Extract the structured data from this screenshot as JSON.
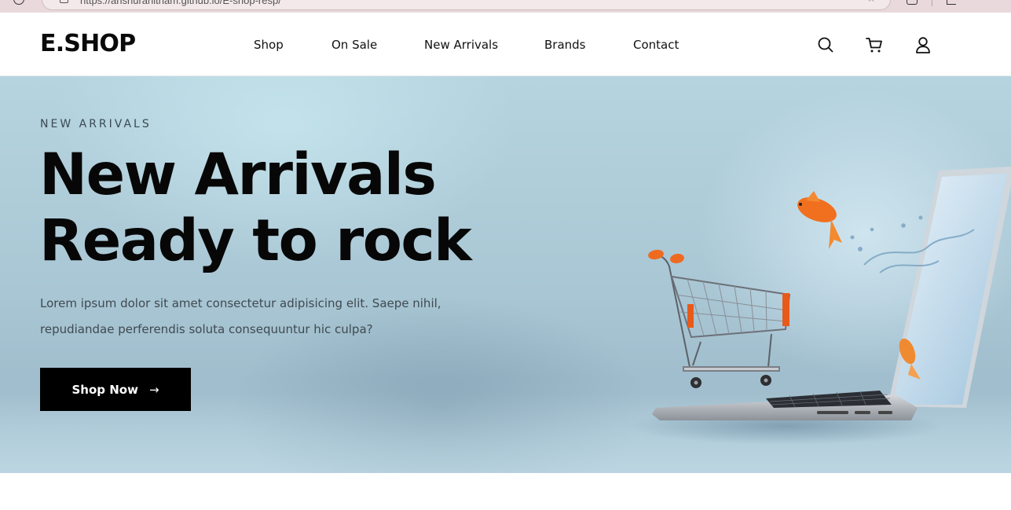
{
  "browser": {
    "url": "https://anshuranitham.github.io/E-shop-resp/"
  },
  "header": {
    "logo": "E.SHOP",
    "nav": [
      {
        "label": "Shop"
      },
      {
        "label": "On Sale"
      },
      {
        "label": "New Arrivals"
      },
      {
        "label": "Brands"
      },
      {
        "label": "Contact"
      }
    ],
    "icons": [
      "search-icon",
      "cart-icon",
      "user-icon"
    ]
  },
  "hero": {
    "eyebrow": "NEW ARRIVALS",
    "headline_line1": "New Arrivals",
    "headline_line2": "Ready to rock",
    "description_line1": "Lorem ipsum dolor sit amet consectetur adipisicing elit. Saepe nihil,",
    "description_line2": "repudiandae perferendis soluta consequuntur hic culpa?",
    "cta_label": "Shop Now",
    "cta_icon": "arrow-right-icon",
    "image_subject": "shopping cart on laptop with goldfish"
  },
  "colors": {
    "brand": "#000000",
    "hero_bg": "#b0ccd8",
    "accent_orange": "#f07020"
  }
}
